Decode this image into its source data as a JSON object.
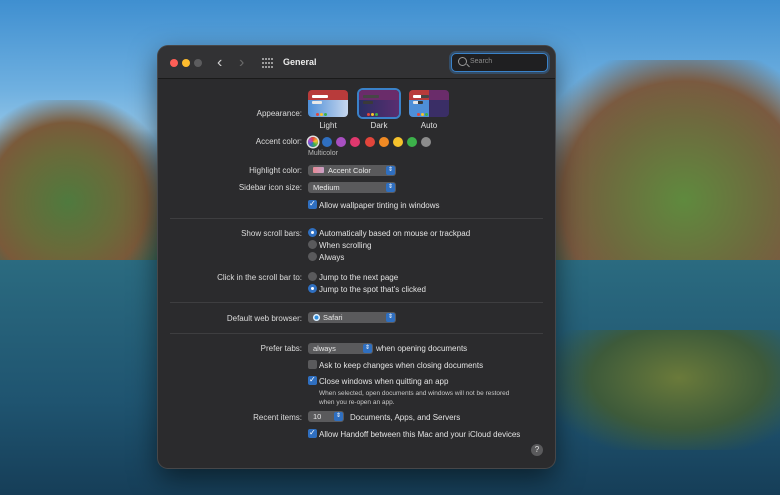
{
  "window": {
    "title": "General"
  },
  "search": {
    "placeholder": "Search"
  },
  "appearance": {
    "label": "Appearance:",
    "options": [
      "Light",
      "Dark",
      "Auto"
    ],
    "selected": "Dark"
  },
  "accent": {
    "label": "Accent color:",
    "selected_name": "Multicolor",
    "colors": [
      "#ac45d6",
      "#2f6fc0",
      "#a84fc1",
      "#e0386e",
      "#e2453b",
      "#f08a24",
      "#f6c22c",
      "#3cb14a",
      "#8c8c8c"
    ]
  },
  "highlight": {
    "label": "Highlight color:",
    "value": "Accent Color"
  },
  "sidebar_icon": {
    "label": "Sidebar icon size:",
    "value": "Medium"
  },
  "wallpaper_tint": {
    "label": "Allow wallpaper tinting in windows",
    "checked": true
  },
  "scroll_bars": {
    "label": "Show scroll bars:",
    "options": [
      "Automatically based on mouse or trackpad",
      "When scrolling",
      "Always"
    ],
    "selected": 0
  },
  "scroll_click": {
    "label": "Click in the scroll bar to:",
    "options": [
      "Jump to the next page",
      "Jump to the spot that's clicked"
    ],
    "selected": 1
  },
  "browser": {
    "label": "Default web browser:",
    "value": "Safari"
  },
  "tabs": {
    "label": "Prefer tabs:",
    "value": "always",
    "suffix": "when opening documents"
  },
  "ask_keep": {
    "label": "Ask to keep changes when closing documents",
    "checked": false
  },
  "close_windows": {
    "label": "Close windows when quitting an app",
    "checked": true,
    "note_line1": "When selected, open documents and windows will not be restored",
    "note_line2": "when you re-open an app."
  },
  "recent": {
    "label": "Recent items:",
    "value": "10",
    "suffix": "Documents, Apps, and Servers"
  },
  "handoff": {
    "label": "Allow Handoff between this Mac and your iCloud devices",
    "checked": true
  },
  "help": {
    "label": "?"
  }
}
